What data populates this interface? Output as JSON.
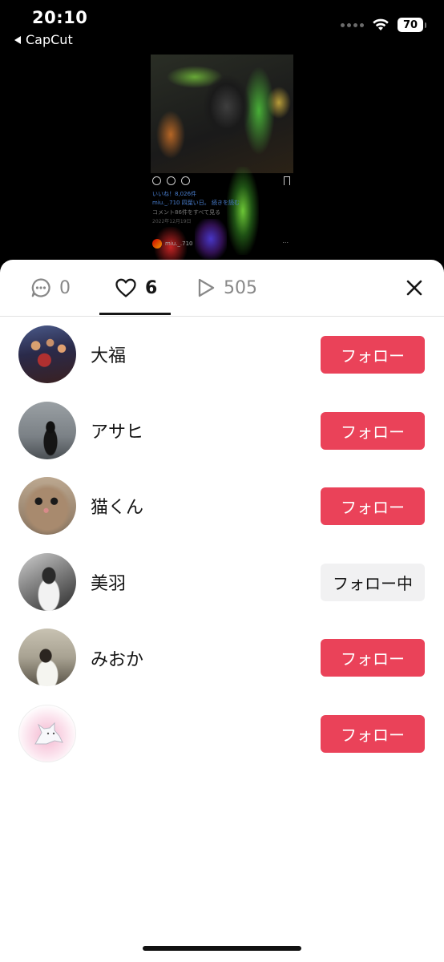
{
  "status_bar": {
    "time": "20:10",
    "back_app": "CapCut",
    "battery_percent": "70"
  },
  "preview": {
    "likes_text": "いいね！8,026件",
    "caption_text": "miu._.710 四葉い日。 続きを読む",
    "comments_text": "コメント86件をすべて見る",
    "date_text": "2022年12月19日",
    "username": "miu._.710",
    "more": "..."
  },
  "tabs": {
    "comments_count": "0",
    "likes_count": "6",
    "views_count": "505",
    "active": "likes"
  },
  "users": [
    {
      "name": "大福",
      "button_label": "フォロー",
      "following": false
    },
    {
      "name": "アサヒ",
      "button_label": "フォロー",
      "following": false
    },
    {
      "name": "猫くん",
      "button_label": "フォロー",
      "following": false
    },
    {
      "name": "美羽",
      "button_label": "フォロー中",
      "following": true
    },
    {
      "name": "みおか",
      "button_label": "フォロー",
      "following": false
    },
    {
      "name": "",
      "button_label": "フォロー",
      "following": false
    }
  ],
  "colors": {
    "follow_button": "#ea4259",
    "following_button": "#f1f1f2",
    "text_primary": "#161616",
    "text_muted": "#888888"
  },
  "icons": {
    "back": "back-triangle-icon",
    "signal": "cellular-signal-icon",
    "wifi": "wifi-icon",
    "battery": "battery-icon",
    "comments_tab": "chat-bubble-icon",
    "likes_tab": "heart-icon",
    "views_tab": "play-icon",
    "close": "close-icon"
  }
}
